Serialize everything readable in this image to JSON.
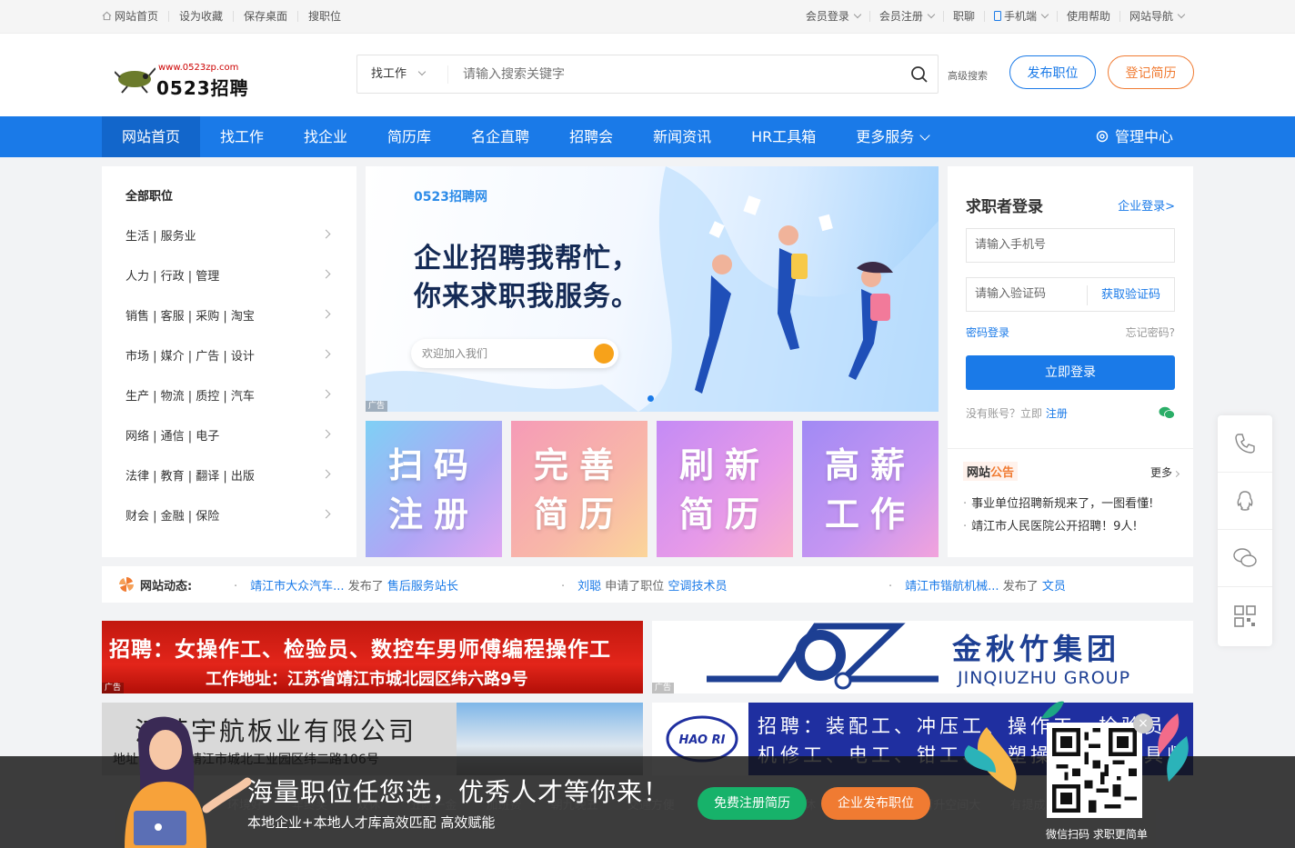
{
  "topbar": {
    "left": [
      "网站首页",
      "设为收藏",
      "保存桌面",
      "搜职位"
    ],
    "right": [
      "会员登录",
      "会员注册",
      "职聊",
      "手机端",
      "使用帮助",
      "网站导航"
    ]
  },
  "header": {
    "logo_url": "www.0523zp.com",
    "logo_name": "0523招聘",
    "search_type": "找工作",
    "search_placeholder": "请输入搜索关键字",
    "advanced": "高级搜索",
    "publish_btn": "发布职位",
    "resume_btn": "登记简历"
  },
  "nav": {
    "items": [
      "网站首页",
      "找工作",
      "找企业",
      "简历库",
      "名企直聘",
      "招聘会",
      "新闻资讯",
      "HR工具箱",
      "更多服务"
    ],
    "manage": "管理中心"
  },
  "categories": {
    "title": "全部职位",
    "items": [
      "生活 | 服务业",
      "人力 | 行政 | 管理",
      "销售 | 客服 | 采购 | 淘宝",
      "市场 | 媒介 | 广告 | 设计",
      "生产 | 物流 | 质控 | 汽车",
      "网络 | 通信 | 电子",
      "法律 | 教育 | 翻译 | 出版",
      "财会 | 金融 | 保险"
    ]
  },
  "banner": {
    "brand": "0523招聘网",
    "line1": "企业招聘我帮忙，",
    "line2": "你来求职我服务。",
    "search_text": "欢迎加入我们",
    "ad_tag": "广告"
  },
  "tiles": [
    {
      "l1": "扫码",
      "l2": "注册"
    },
    {
      "l1": "完善",
      "l2": "简历"
    },
    {
      "l1": "刷新",
      "l2": "简历"
    },
    {
      "l1": "高薪",
      "l2": "工作"
    }
  ],
  "login": {
    "title": "求职者登录",
    "company_link": "企业登录>",
    "phone_placeholder": "请输入手机号",
    "code_placeholder": "请输入验证码",
    "get_code": "获取验证码",
    "pw_login": "密码登录",
    "forgot": "忘记密码?",
    "submit": "立即登录",
    "no_account": "没有账号？立即",
    "register": "注册"
  },
  "notice": {
    "h1": "网站",
    "h2": "公告",
    "more": "更多",
    "items": [
      "事业单位招聘新规来了，一图看懂!",
      "靖江市人民医院公开招聘！9人!"
    ]
  },
  "dynamics": {
    "label": "网站动态:",
    "items": [
      {
        "who": "靖江市大众汽车...",
        "verb": "发布了",
        "what": "售后服务站长"
      },
      {
        "who": "刘聪",
        "verb": "申请了职位",
        "what": "空调技术员"
      },
      {
        "who": "靖江市锴航机械...",
        "verb": "发布了",
        "what": "文员"
      }
    ]
  },
  "ads": {
    "ad1_line1": "招聘：女操作工、检验员、数控车男师傅编程操作工",
    "ad1_line2": "工作地址：江苏省靖江市城北园区纬六路9号",
    "ad2_cn": "金秋竹集团",
    "ad2_en": "JINQIUZHU GROUP",
    "ad3_cn": "江苏宇航板业有限公司",
    "ad3_addr": "地址：江苏省靖江市城北工业园区纬二路106号",
    "ad4_logo": "HAO RI",
    "ad4_l1": "招聘：装配工、冲压工、操作工、检验员、",
    "ad4_l2": "机修工、电工、钳工、注塑操作工、模具师",
    "ad_tag": "广告"
  },
  "bottom": {
    "headline": "海量职位任您选，优秀人才等你来！",
    "sub": "本地企业+本地人才库高效匹配 高效赋能",
    "ghost_tags": "环境好 年终奖 双休 五险一金 加班费 朝九晚五 交通方便 包吃住 周末双休 弹性工作 晋升空间大 有提成 全勤奖",
    "btn_free": "免费注册简历",
    "btn_pub": "企业发布职位",
    "qr_text": "微信扫码 求职更简单",
    "close": "×"
  },
  "colors": {
    "primary": "#1a7ae8",
    "orange": "#f07b32",
    "green": "#17b26a"
  }
}
